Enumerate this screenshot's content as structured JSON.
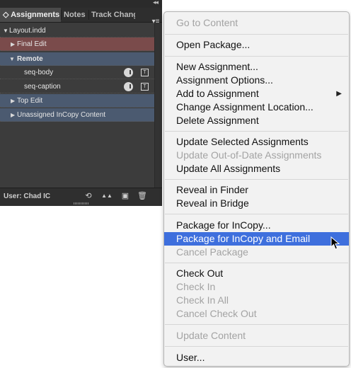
{
  "panel": {
    "collapse_glyph": "◂◂",
    "tabs": [
      {
        "label": "◇ Assignments",
        "active": true
      },
      {
        "label": "Notes",
        "active": false
      },
      {
        "label": "Track Chang",
        "active": false
      }
    ],
    "menu_glyph": "▾≡",
    "rows": [
      {
        "label": "Layout.indd",
        "expanded": true
      },
      {
        "label": "Final Edit",
        "expanded": false
      },
      {
        "label": "Remote",
        "expanded": true
      },
      {
        "label": "seq-body"
      },
      {
        "label": "seq-caption"
      },
      {
        "label": "Top Edit",
        "expanded": false
      },
      {
        "label": "Unassigned InCopy Content",
        "expanded": false
      }
    ],
    "row_icon_text": "T",
    "user_label": "User: Chad IC",
    "footer_icons": [
      "⟲",
      "▲▲",
      "▣",
      "🗑"
    ],
    "colors": {
      "final_edit": "#7a4b4b",
      "remote": "#4b5a70",
      "top_edit": "#4b5a70",
      "unassigned": "#4b5a70"
    }
  },
  "menu": {
    "items": [
      {
        "label": "Go to Content",
        "disabled": true
      },
      {
        "label": "Open Package...",
        "disabled": false
      },
      {
        "label": "New Assignment...",
        "disabled": false
      },
      {
        "label": "Assignment Options...",
        "disabled": false
      },
      {
        "label": "Add to Assignment",
        "disabled": false,
        "submenu": true
      },
      {
        "label": "Change Assignment Location...",
        "disabled": false
      },
      {
        "label": "Delete Assignment",
        "disabled": false
      },
      {
        "label": "Update Selected Assignments",
        "disabled": false
      },
      {
        "label": "Update Out-of-Date Assignments",
        "disabled": true
      },
      {
        "label": "Update All Assignments",
        "disabled": false
      },
      {
        "label": "Reveal in Finder",
        "disabled": false
      },
      {
        "label": "Reveal in Bridge",
        "disabled": false
      },
      {
        "label": "Package for InCopy...",
        "disabled": false
      },
      {
        "label": "Package for InCopy and Email",
        "disabled": false,
        "highlighted": true
      },
      {
        "label": "Cancel Package",
        "disabled": true
      },
      {
        "label": "Check Out",
        "disabled": false
      },
      {
        "label": "Check In",
        "disabled": true
      },
      {
        "label": "Check In All",
        "disabled": true
      },
      {
        "label": "Cancel Check Out",
        "disabled": true
      },
      {
        "label": "Update Content",
        "disabled": true
      },
      {
        "label": "User...",
        "disabled": false
      }
    ],
    "submenu_arrow": "▶",
    "highlight_color": "#3e6fdd"
  }
}
